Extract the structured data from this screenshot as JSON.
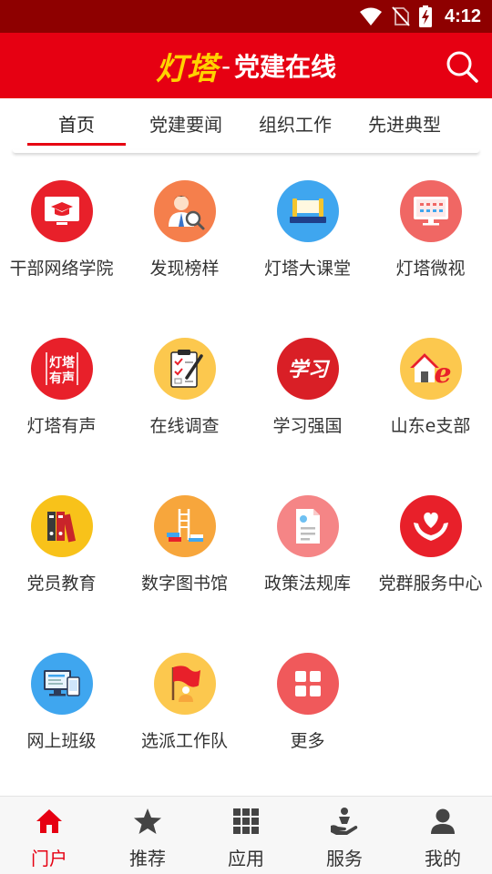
{
  "status_bar": {
    "time": "4:12"
  },
  "header": {
    "brand": "灯塔",
    "dash": "-",
    "subtitle": "党建在线"
  },
  "tabs": [
    {
      "label": "首页",
      "active": true
    },
    {
      "label": "党建要闻",
      "active": false
    },
    {
      "label": "组织工作",
      "active": false
    },
    {
      "label": "先进典型",
      "active": false
    }
  ],
  "grid": [
    {
      "label": "干部网络学院",
      "icon": "graduation-cap-monitor-icon",
      "color": "#e8202a"
    },
    {
      "label": "发现榜样",
      "icon": "person-search-icon",
      "color": "#f57f4c"
    },
    {
      "label": "灯塔大课堂",
      "icon": "book-stage-icon",
      "color": "#3fa6ef"
    },
    {
      "label": "灯塔微视",
      "icon": "monitor-icon",
      "color": "#f06764"
    },
    {
      "label": "灯塔有声",
      "icon": "audio-logo-icon",
      "color": "#e8202a",
      "logo_text_1": "灯塔",
      "logo_text_2": "有声"
    },
    {
      "label": "在线调查",
      "icon": "clipboard-survey-icon",
      "color": "#fcc84e"
    },
    {
      "label": "学习强国",
      "icon": "xuexi-logo-icon",
      "color": "#d91f26",
      "logo_text": "学习"
    },
    {
      "label": "山东e支部",
      "icon": "house-e-icon",
      "color": "#fcc84e"
    },
    {
      "label": "党员教育",
      "icon": "binders-icon",
      "color": "#f8c21a"
    },
    {
      "label": "数字图书馆",
      "icon": "ladder-books-icon",
      "color": "#f7a63c"
    },
    {
      "label": "政策法规库",
      "icon": "document-icon",
      "color": "#f58586"
    },
    {
      "label": "党群服务中心",
      "icon": "hands-heart-icon",
      "color": "#e8202a"
    },
    {
      "label": "网上班级",
      "icon": "computer-tablet-icon",
      "color": "#3fa6ef"
    },
    {
      "label": "选派工作队",
      "icon": "flag-person-icon",
      "color": "#fcc84e"
    },
    {
      "label": "更多",
      "icon": "more-grid-icon",
      "color": "#f0595b"
    }
  ],
  "bottom_nav": [
    {
      "label": "门户",
      "icon": "home-icon",
      "active": true
    },
    {
      "label": "推荐",
      "icon": "star-icon",
      "active": false
    },
    {
      "label": "应用",
      "icon": "apps-grid-icon",
      "active": false
    },
    {
      "label": "服务",
      "icon": "service-hand-icon",
      "active": false
    },
    {
      "label": "我的",
      "icon": "user-icon",
      "active": false
    }
  ],
  "colors": {
    "primary": "#e60012",
    "status_bar": "#8e0000",
    "brand_yellow": "#ffd200"
  }
}
